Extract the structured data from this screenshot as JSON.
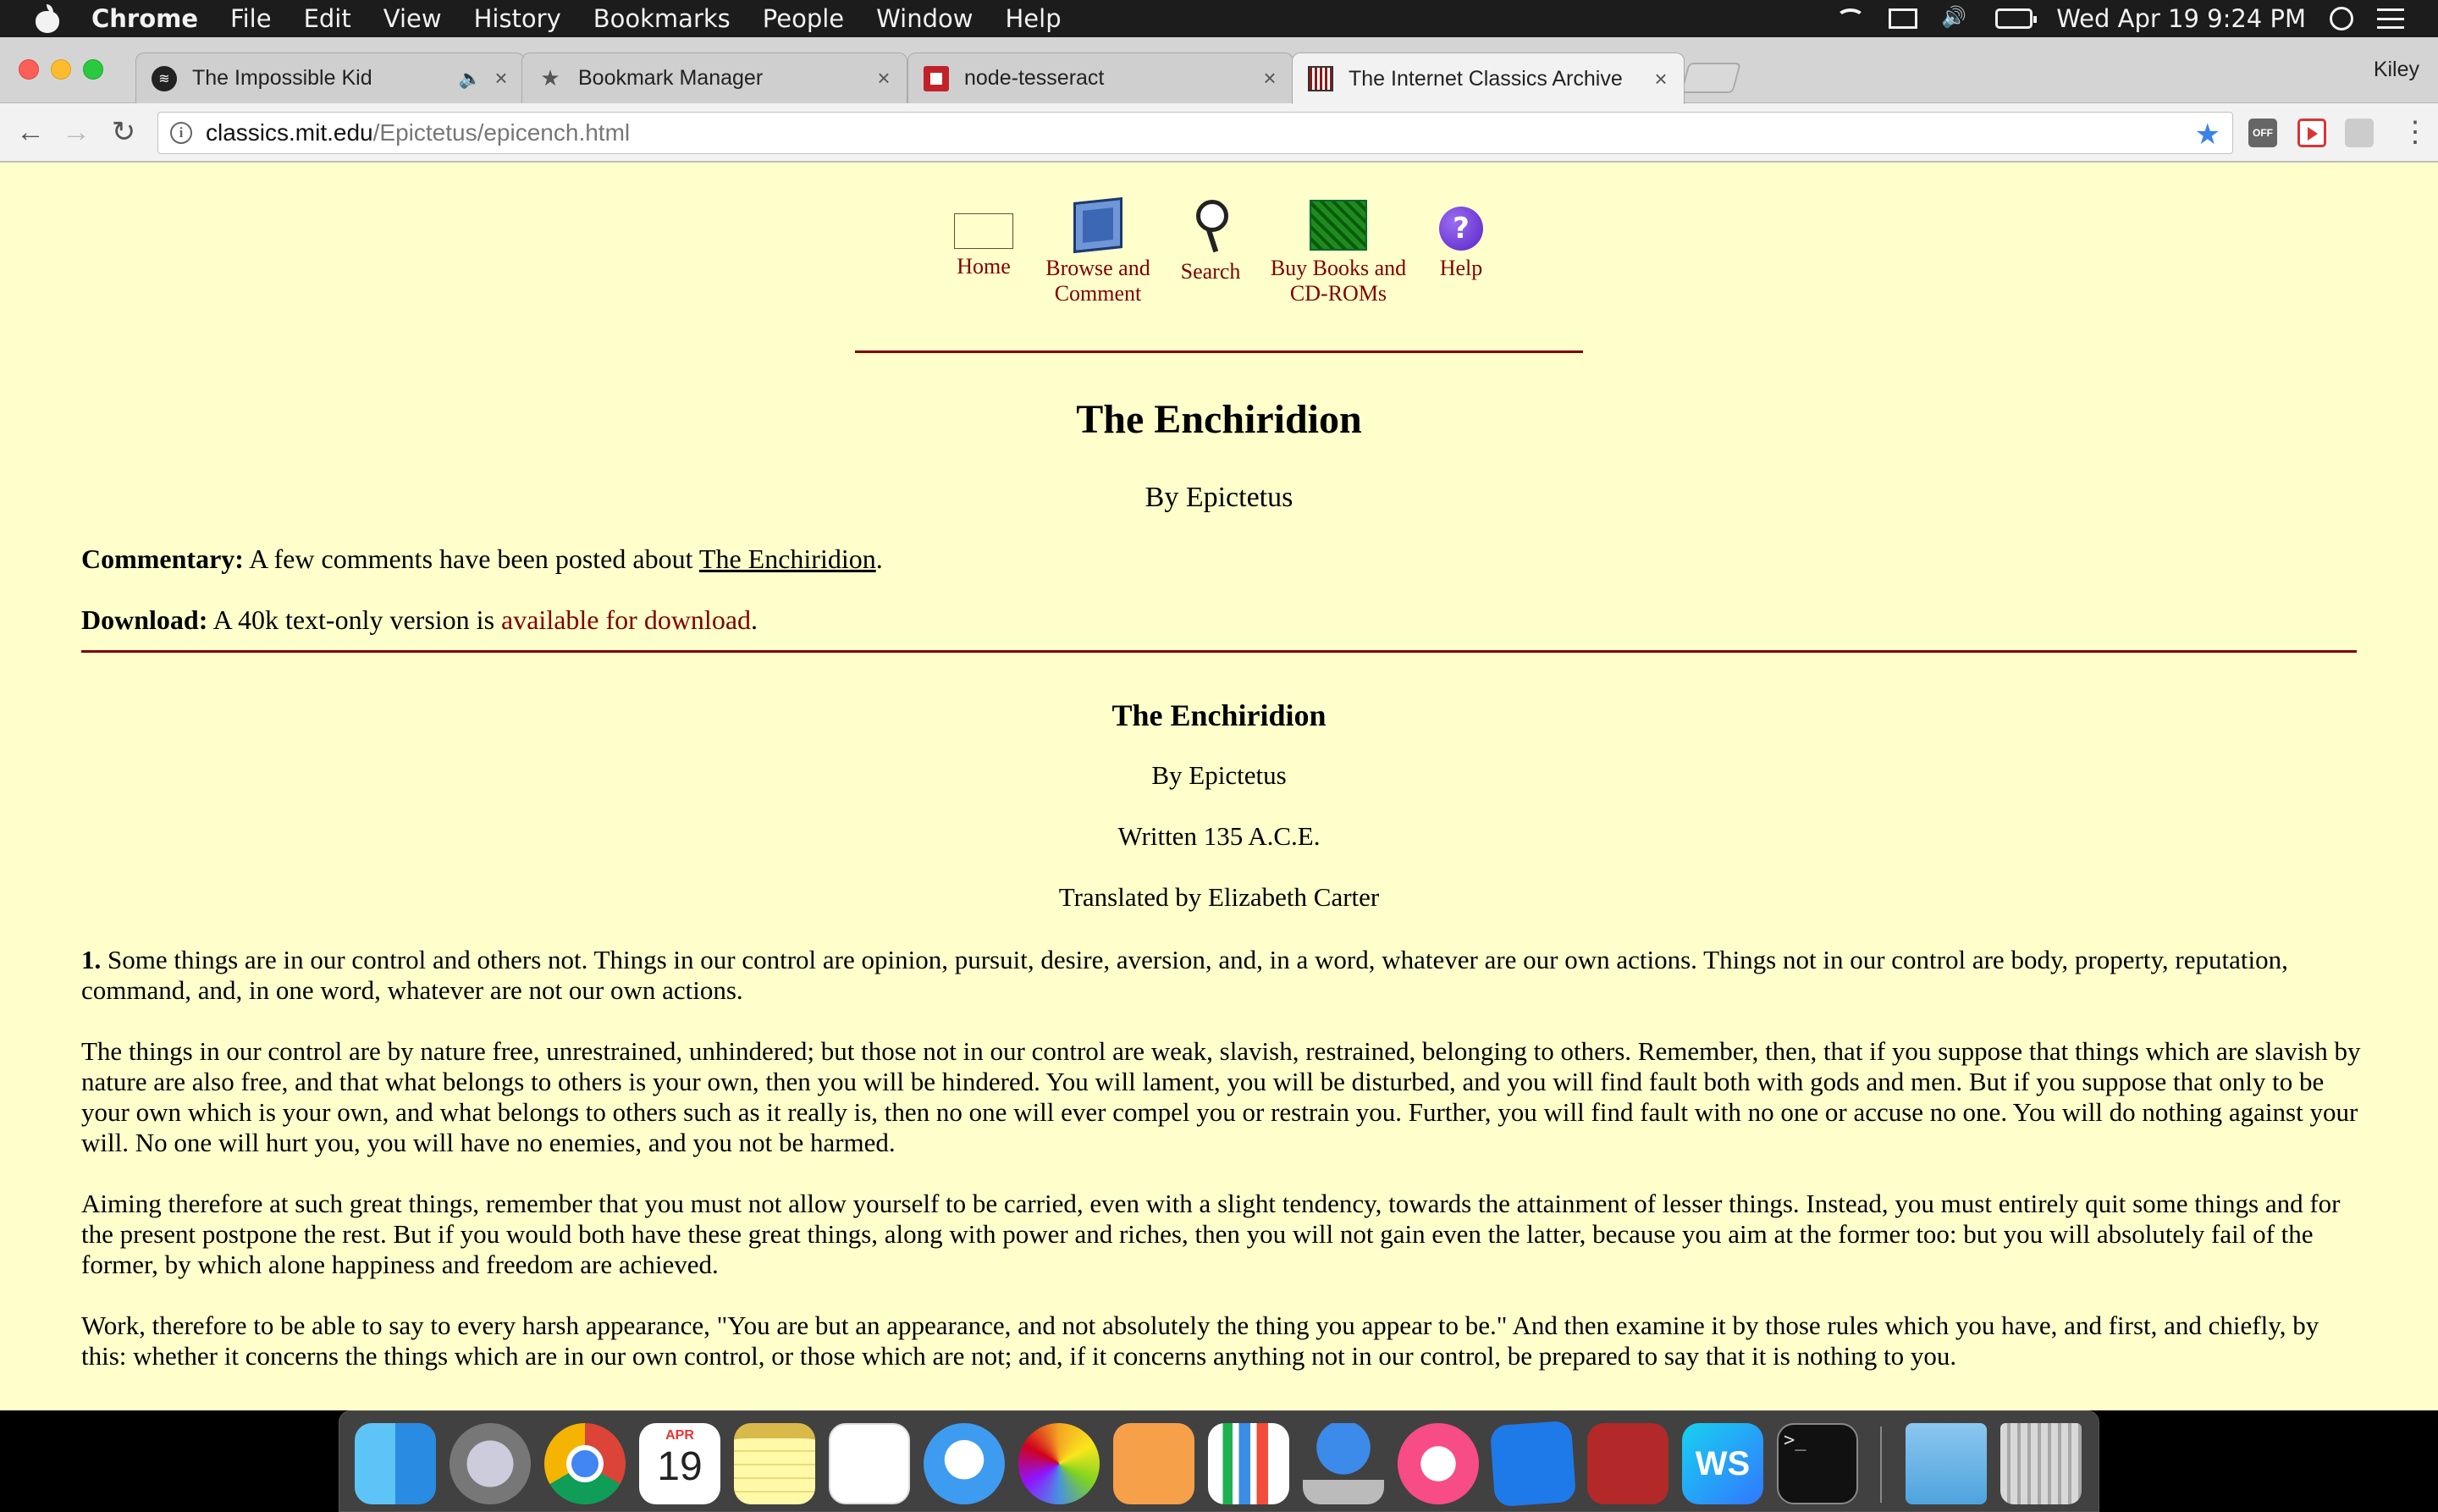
{
  "menubar": {
    "app": "Chrome",
    "items": [
      "File",
      "Edit",
      "View",
      "History",
      "Bookmarks",
      "People",
      "Window",
      "Help"
    ],
    "clock": "Wed Apr 19  9:24 PM"
  },
  "browser": {
    "tabs": [
      {
        "label": "The Impossible Kid",
        "icon": "spotify-icon"
      },
      {
        "label": "Bookmark Manager",
        "icon": "star-icon"
      },
      {
        "label": "node-tesseract",
        "icon": "npm-icon"
      },
      {
        "label": "The Internet Classics Archive",
        "icon": "mit-icon"
      }
    ],
    "profile": "Kiley",
    "url_host": "classics.mit.edu",
    "url_path": "/Epictetus/epicench.html",
    "ext_off_label": "OFF"
  },
  "page": {
    "nav": [
      {
        "label_line1": "Home",
        "label_line2": ""
      },
      {
        "label_line1": "Browse and",
        "label_line2": "Comment"
      },
      {
        "label_line1": "Search",
        "label_line2": ""
      },
      {
        "label_line1": "Buy Books and",
        "label_line2": "CD-ROMs"
      },
      {
        "label_line1": "Help",
        "label_line2": ""
      }
    ],
    "title": "The Enchiridion",
    "byline": "By Epictetus",
    "commentary_label": "Commentary:",
    "commentary_text": " A few comments have been posted about ",
    "commentary_link": "The Enchiridion",
    "commentary_end": ".",
    "download_label": "Download:",
    "download_text": " A 40k text-only version is ",
    "download_link": "available for download",
    "download_end": ".",
    "sub_title": "The Enchiridion",
    "sub_byline": "By Epictetus",
    "written": "Written 135 A.C.E.",
    "translated": "Translated by Elizabeth Carter",
    "p1_num": "1.",
    "p1": " Some things are in our control and others not. Things in our control are opinion, pursuit, desire, aversion, and, in a word, whatever are our own actions. Things not in our control are body, property, reputation, command, and, in one word, whatever are not our own actions.",
    "p2": "The things in our control are by nature free, unrestrained, unhindered; but those not in our control are weak, slavish, restrained, belonging to others. Remember, then, that if you suppose that things which are slavish by nature are also free, and that what belongs to others is your own, then you will be hindered. You will lament, you will be disturbed, and you will find fault both with gods and men. But if you suppose that only to be your own which is your own, and what belongs to others such as it really is, then no one will ever compel you or restrain you. Further, you will find fault with no one or accuse no one. You will do nothing against your will. No one will hurt you, you will have no enemies, and you not be harmed.",
    "p3": "Aiming therefore at such great things, remember that you must not allow yourself to be carried, even with a slight tendency, towards the attainment of lesser things. Instead, you must entirely quit some things and for the present postpone the rest. But if you would both have these great things, along with power and riches, then you will not gain even the latter, because you aim at the former too: but you will absolutely fail of the former, by which alone happiness and freedom are achieved.",
    "p4": "Work, therefore to be able to say to every harsh appearance, \"You are but an appearance, and not absolutely the thing you appear to be.\" And then examine it by those rules which you have, and first, and chiefly, by this: whether it concerns the things which are in our own control, or those which are not; and, if it concerns anything not in our control, be prepared to say that it is nothing to you."
  },
  "dock": {
    "calendar_month": "APR",
    "calendar_day": "19",
    "apps": [
      "finder-icon",
      "launchpad-icon",
      "chrome-icon",
      "calendar-icon",
      "notes-icon",
      "reminders-icon",
      "messages-icon",
      "photos-icon",
      "pages-icon",
      "numbers-icon",
      "keynote-icon",
      "itunes-icon",
      "xcode-icon",
      "photo-booth-icon",
      "webstorm-icon",
      "terminal-icon",
      "downloads-folder-icon",
      "trash-icon"
    ]
  }
}
